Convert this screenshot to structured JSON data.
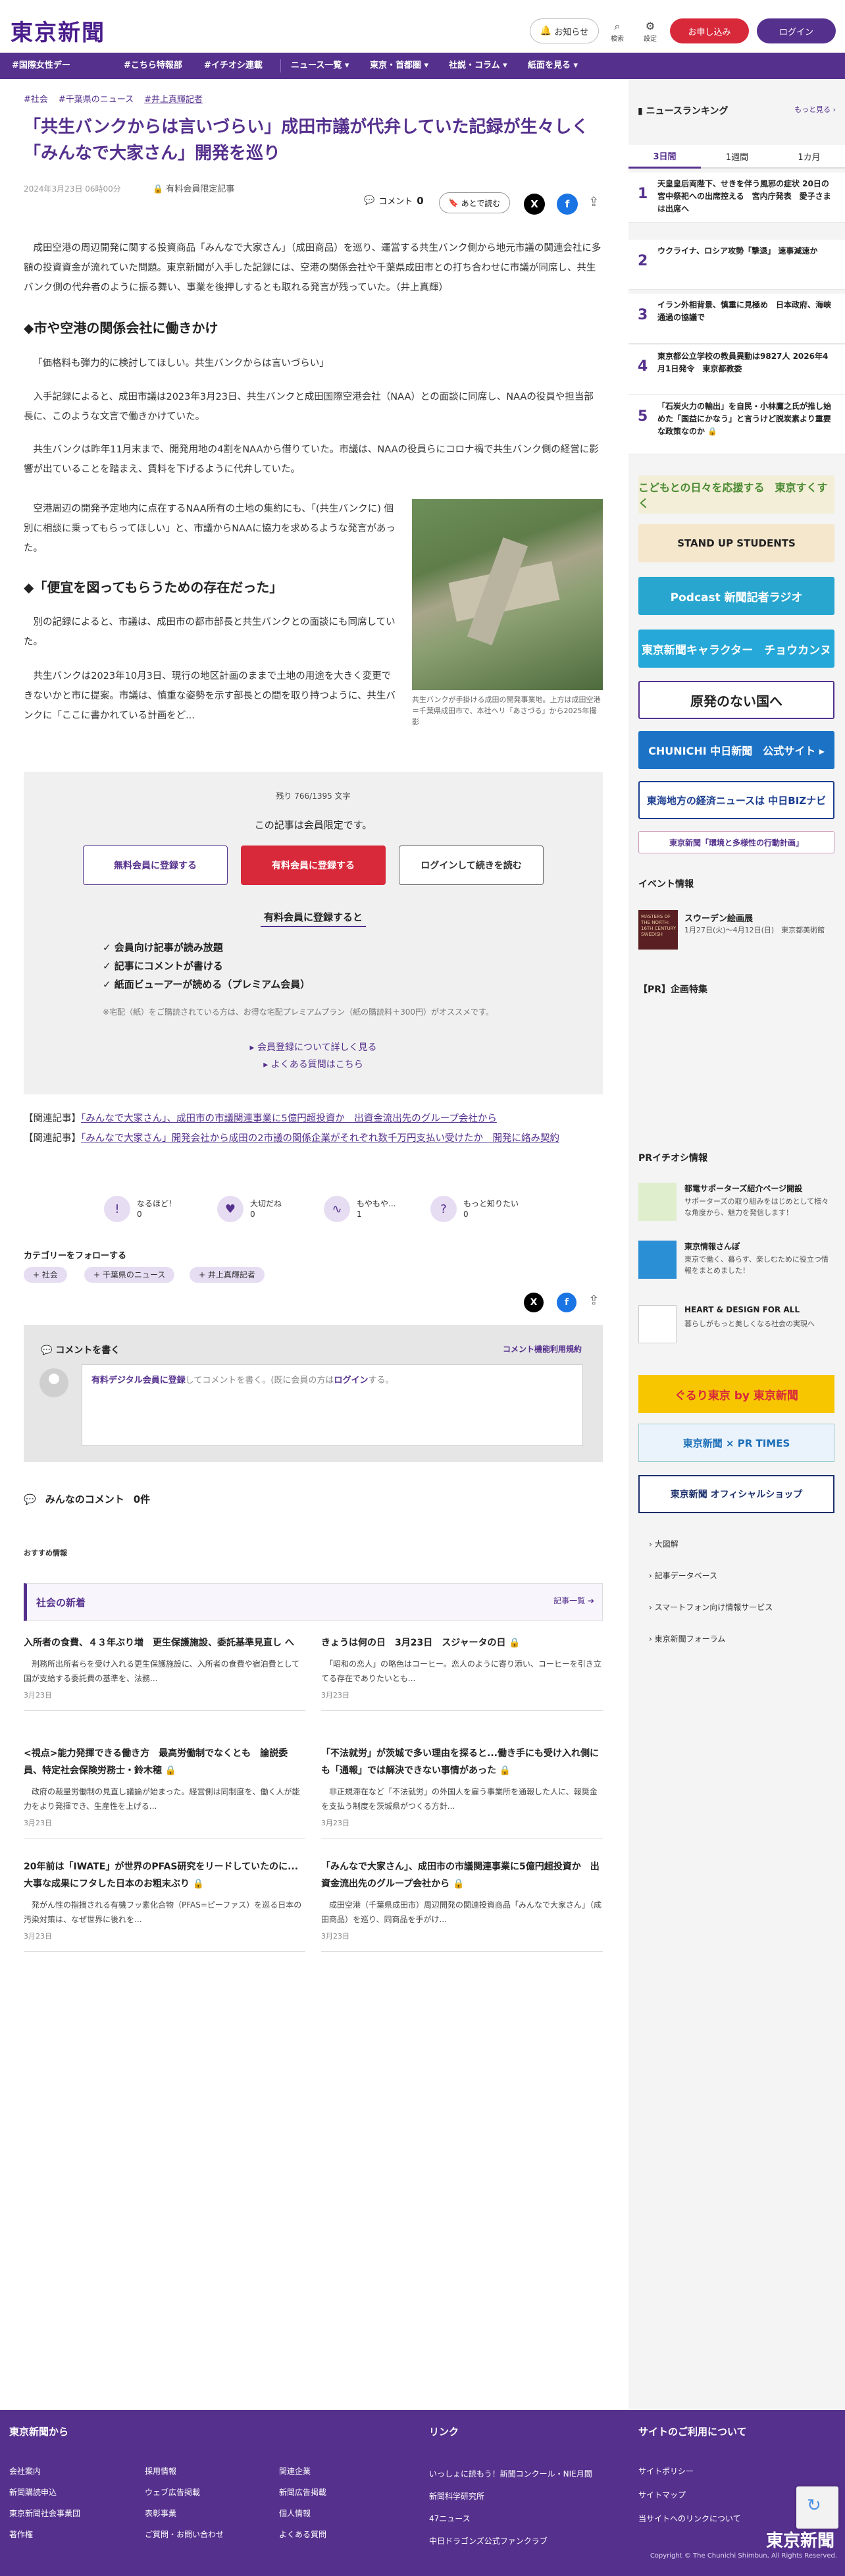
{
  "header": {
    "logo": "東京新聞",
    "notice": "お知らせ",
    "search": "検索",
    "settings": "設定",
    "paid": "お申し込み",
    "login": "ログイン"
  },
  "nav": [
    "#国際女性デー",
    "#こちら特報部",
    "#イチオシ連載",
    "ニュース一覧 ▾",
    "東京・首都圏 ▾",
    "社説・コラム ▾",
    "紙面を見る ▾"
  ],
  "article": {
    "tags": [
      "#社会",
      "#千葉県のニュース",
      "#井上真輝記者"
    ],
    "title": "「共生バンクからは言いづらい」成田市議が代弁していた記録が生々しく 「みんなで大家さん」開発を巡り",
    "date": "2024年3月23日 06時00分",
    "member_label": "有料会員限定記事",
    "comment_label": "コメント",
    "comment_count": "0",
    "read_later": "あとで読む",
    "p1": "　成田空港の周辺開発に関する投資商品「みんなで大家さん」（成田商品）を巡り、運営する共生バンク側から地元市議の関連会社に多額の投資資金が流れていた問題。東京新聞が入手した記録には、空港の関係会社や千葉県成田市との打ち合わせに市議が同席し、共生バンク側の代弁者のように振る舞い、事業を後押しするとも取れる発言が残っていた。（井上真輝）",
    "h1": "◆市や空港の関係会社に働きかけ",
    "q1": "「価格料も弾力的に検討してほしい。共生バンクからは言いづらい」",
    "p2": "　入手記録によると、成田市議は2023年3月23日、共生バンクと成田国際空港会社（NAA）との面談に同席し、NAAの役員や担当部長に、このような文言で働きかけていた。",
    "p3": "　共生バンクは昨年11月末まで、開発用地の4割をNAAから借りていた。市議は、NAAの役員らにコロナ禍で共生バンク側の経営に影響が出ていることを踏まえ、賃料を下げるように代弁していた。",
    "p4": "　空港周辺の開発予定地内に点在するNAA所有の土地の集約にも、「(共生バンクに) 個別に相談に乗ってもらってほしい」と、市議からNAAに協力を求めるような発言があった。",
    "h2": "◆「便宜を図ってもらうための存在だった」",
    "p5": "　別の記録によると、市議は、成田市の都市部長と共生バンクとの面談にも同席していた。",
    "p6": "　共生バンクは2023年10月3日、現行の地区計画のままで土地の用途を大きく変更できないかと市に提案。市議は、慎重な姿勢を示す部長との間を取り持つように、共生バンクに「ここに書かれている計画をど...",
    "photo_caption": "共生バンクが手掛ける成田の開発事業地。上方は成田空港＝千葉県成田市で、本社ヘリ「あさづる」から2025年撮影"
  },
  "paywall": {
    "remaining": "残り 766/1395 文字",
    "limited": "この記事は会員限定です。",
    "free": "無料会員に登録する",
    "paid": "有料会員に登録する",
    "login": "ログインして続きを読む",
    "sub": "有料会員に登録すると",
    "benefits": [
      "✓ 会員向け記事が読み放題",
      "✓ 記事にコメントが書ける",
      "✓ 紙面ビューアーが読める（プレミアム会員）"
    ],
    "note": "※宅配（紙）をご購読されている方は、お得な宅配プレミアムプラン（紙の購読料＋300円）がオススメです。",
    "link1": "▸ 会員登録について詳しく見る",
    "link2": "▸ よくある質問はこちら"
  },
  "related": [
    {
      "prefix": "【関連記事】",
      "text": "「みんなで大家さん」、成田市の市議関連事業に5億円超投資か　出資金流出先のグループ会社から"
    },
    {
      "prefix": "【関連記事】",
      "text": "「みんなで大家さん」開発会社から成田の2市議の関係企業がそれぞれ数千万円支払い受けたか　開発に絡み契約"
    }
  ],
  "reactions": [
    {
      "label": "なるほど！",
      "count": "0",
      "icon": "!"
    },
    {
      "label": "大切だね",
      "count": "0",
      "icon": "♥"
    },
    {
      "label": "もやもや...",
      "count": "1",
      "icon": "∿"
    },
    {
      "label": "もっと知りたい",
      "count": "0",
      "icon": "?"
    }
  ],
  "follow": {
    "heading": "カテゴリーをフォローする",
    "chips": [
      "+ 社会",
      "+ 千葉県のニュース",
      "+ 井上真輝記者"
    ]
  },
  "comments": {
    "heading": "コメントを書く",
    "rules": "コメント機能利用規約",
    "prompt_link": "有料デジタル会員に登録",
    "prompt_mid": "してコメントを書く。(既に会員の方は",
    "prompt_login": "ログイン",
    "prompt_end": "する。",
    "all": "みんなのコメント",
    "all_count": "0件"
  },
  "recommend": "おすすめ情報",
  "latest": {
    "heading": "社会の新着",
    "more": "記事一覧 ➔",
    "cards": [
      {
        "title": "入所者の食費、４３年ぶり増　更生保護施設、委託基準見直し へ",
        "desc": "　刑務所出所者らを受け入れる更生保護施設に、入所者の食費や宿泊費として国が支給する委託費の基準を、法務...",
        "date": "3月23日"
      },
      {
        "title": "きょうは何の日　3月23日　スジャータの日 🔒",
        "desc": "　「昭和の恋人」の略色はコーヒー。恋人のように寄り添い、コーヒーを引き立てる存在でありたいとも...",
        "date": "3月23日"
      },
      {
        "title": "<視点>能力発揮できる働き方　最高労働制でなくとも　論説委員、特定社会保険労務士・鈴木穂 🔒",
        "desc": "　政府の裁量労働制の見直し議論が始まった。経営側は同制度を、働く人が能力をより発揮でき、生産性を上げる...",
        "date": "3月23日"
      },
      {
        "title": "「不法就労」が茨城で多い理由を探ると...働き手にも受け入れ側にも「通報」では解決できない事情があった 🔒",
        "desc": "　非正規滞在など「不法就労」の外国人を雇う事業所を通報した人に、報奨金を支払う制度を茨城県がつくる方針...",
        "date": "3月23日"
      },
      {
        "title": "20年前は「IWATE」が世界のPFAS研究をリードしていたのに...大事な成果にフタした日本のお粗末ぶり 🔒",
        "desc": "　発がん性の指摘される有機フッ素化合物（PFAS=ピーファス）を巡る日本の汚染対策は、なぜ世界に後れを...",
        "date": "3月23日"
      },
      {
        "title": "「みんなで大家さん」、成田市の市議関連事業に5億円超投資か　出資金流出先のグループ会社から 🔒",
        "desc": "　成田空港（千葉県成田市）周辺開発の関連投資商品「みんなで大家さん」（成田商品）を巡り、同商品を手がけ...",
        "date": "3月23日"
      }
    ]
  },
  "sidebar": {
    "ranking": "ニュースランキング",
    "more": "もっと見る ›",
    "tabs": [
      "3日間",
      "1週間",
      "1カ月"
    ],
    "items": [
      "天皇皇后両陛下、せきを伴う風邪の症状 20日の宮中祭祀への出席控える　宮内庁発表　愛子さまは出席へ",
      "ウクライナ、ロシア攻勢「撃退」 速事減速か",
      "イラン外相背景、慎重に見極め　日本政府、海峡通過の協議で",
      "東京都公立学校の教員異動は9827人 2026年4月1日発令　東京都教委",
      "「石炭火力の輸出」を自民・小林鷹之氏が推し始めた「国益にかなう」と言うけど脱炭素より重要な政策なのか 🔒"
    ],
    "ads": [
      "こどもとの日々を応援する　東京すくすく",
      "STAND UP STUDENTS",
      "Podcast 新聞記者ラジオ",
      "東京新聞キャラクター　チョウカンヌ",
      "原発のない国へ",
      "CHUNICHI 中日新聞　公式サイト ▸",
      "東海地方の経済ニュースは 中日BIZナビ",
      "東京新聞「環境と多様性の行動計画」"
    ],
    "event_heading": "イベント情報",
    "event": {
      "img_text": "MASTERS OF THE NORTH: 16TH CENTURY SWEDISH",
      "title": "スウーデン絵画展",
      "desc": "1月27日(火)〜4月12日(日)　東京都美術館"
    },
    "pr_heading": "【PR】企画特集",
    "prichi_heading": "PRイチオシ情報",
    "prichi": [
      {
        "title": "都電サポーターズ紹介ページ開設",
        "desc": "サポーターズの取り組みをはじめとして様々な角度から、魅力を発信します！"
      },
      {
        "title": "東京情報さんぽ",
        "desc": "東京で働く、暮らす、楽しむために役立つ情報をまとめました！"
      },
      {
        "title": "HEART & DESIGN FOR ALL",
        "desc": "暮らしがもっと美しくなる社会の実現へ"
      }
    ],
    "ads2": [
      "ぐるり東京 by 東京新聞",
      "東京新聞 × PR TIMES",
      "東京新聞 オフィシャルショップ"
    ],
    "links": [
      "› 大図解",
      "› 記事データベース",
      "› スマートフォン向け情報サービス",
      "› 東京新聞フォーラム"
    ]
  },
  "footer": {
    "col1": "東京新聞から",
    "col2": "リンク",
    "col3": "サイトのご利用について",
    "a": [
      "会社案内",
      "新聞購読申込",
      "東京新聞社会事業団",
      "著作権"
    ],
    "b": [
      "採用情報",
      "ウェブ広告掲載",
      "表彰事業",
      "ご質問・お問い合わせ"
    ],
    "c": [
      "関連企業",
      "新聞広告掲載",
      "個人情報",
      "よくある質問"
    ],
    "d": [
      "いっしょに読もう！新聞コンクール・NIE月間",
      "新聞科学研究所",
      "47ニュース",
      "中日ドラゴンズ公式ファンクラブ"
    ],
    "e": [
      "サイトポリシー",
      "サイトマップ",
      "当サイトへのリンクについて"
    ],
    "logo": "東京新聞",
    "copyright": "Copyright © The Chunichi Shimbun, All Rights Reserved."
  }
}
